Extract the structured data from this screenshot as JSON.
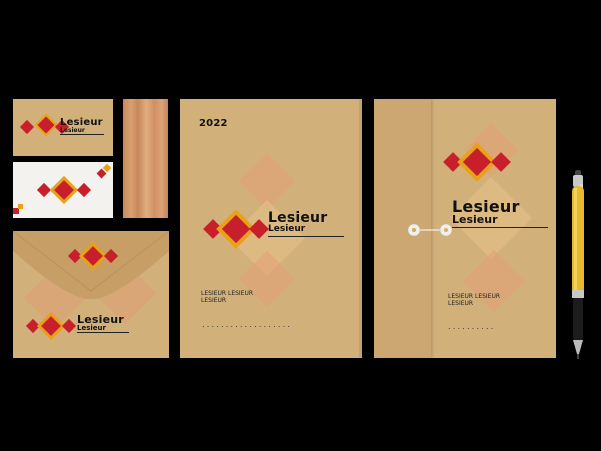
{
  "brand": {
    "name": "Lesieur",
    "subname": "Lesieur",
    "colors": {
      "kraft": "#d2b07a",
      "red": "#c7202a",
      "gold": "#e8a21a",
      "peach": "#e39b75",
      "ink": "#111111"
    }
  },
  "folder": {
    "year": "2022",
    "footer_line1": "LESIEUR LESIEUR",
    "footer_line2": "LESIEUR",
    "dots": "..................."
  },
  "envelope_folder": {
    "footer_line1": "LESIEUR LESIEUR",
    "footer_line2": "LESIEUR",
    "dots": ".........."
  },
  "pen": {
    "icon": "ballpoint-pen-icon"
  }
}
